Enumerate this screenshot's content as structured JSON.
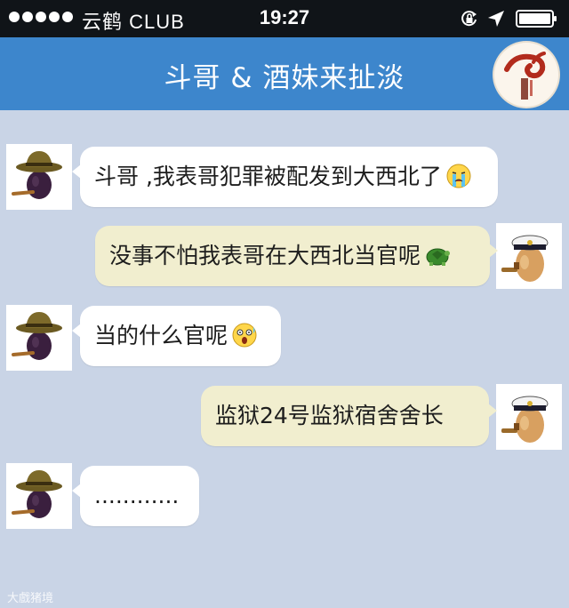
{
  "status_bar": {
    "carrier": "云鹤 CLUB",
    "time": "19:27"
  },
  "header": {
    "title": "斗哥 & 酒妹来扯淡"
  },
  "messages": [
    {
      "sender": "left",
      "avatar": "eggplant-hat-avatar",
      "text": "斗哥 ,我表哥犯罪被配发到大西北了",
      "emoji": "crying-emoji"
    },
    {
      "sender": "right",
      "avatar": "captain-egg-avatar",
      "text": "没事不怕我表哥在大西北当官呢",
      "emoji": "turtle-emoji"
    },
    {
      "sender": "left",
      "avatar": "eggplant-hat-avatar",
      "text": "当的什么官呢",
      "emoji": "shocked-emoji"
    },
    {
      "sender": "right",
      "avatar": "captain-egg-avatar",
      "text": "监狱24号监狱宿舍舍长",
      "emoji": ""
    },
    {
      "sender": "left",
      "avatar": "eggplant-hat-avatar",
      "text": "............",
      "emoji": ""
    }
  ],
  "watermark": "大戲猪境",
  "colors": {
    "status_bg": "#101418",
    "nav_bg": "#3d86cc",
    "chat_bg": "#c9d4e6",
    "bubble_in": "#ffffff",
    "bubble_out": "#f1eecf"
  }
}
